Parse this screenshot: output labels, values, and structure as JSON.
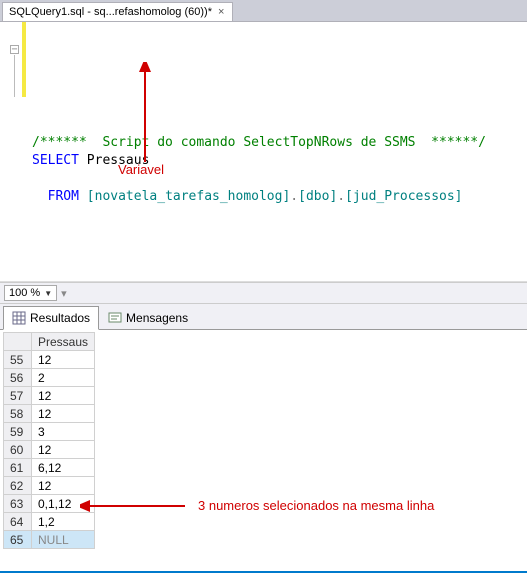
{
  "tab": {
    "title": "SQLQuery1.sql - sq...refashomolog (60))*"
  },
  "code": {
    "comment": "/******  Script do comando SelectTopNRows de SSMS  ******/",
    "select_kw": "SELECT",
    "select_col": "Pressaus",
    "from_kw": "FROM",
    "obj_open": "[",
    "obj_db": "novatela_tarefas_homolog",
    "obj_sep": "].[",
    "obj_schema": "dbo",
    "obj_sep2": "].[",
    "obj_table": "jud_Processos",
    "obj_close": "]"
  },
  "annotations": {
    "variavel": "Variavel",
    "rowline": "3 numeros selecionados na mesma linha"
  },
  "zoom": {
    "value": "100 %"
  },
  "result_tabs": {
    "results": "Resultados",
    "messages": "Mensagens"
  },
  "grid": {
    "column": "Pressaus",
    "rows": [
      {
        "n": "55",
        "v": "12"
      },
      {
        "n": "56",
        "v": "2"
      },
      {
        "n": "57",
        "v": "12"
      },
      {
        "n": "58",
        "v": "12"
      },
      {
        "n": "59",
        "v": "3"
      },
      {
        "n": "60",
        "v": "12"
      },
      {
        "n": "61",
        "v": "6,12"
      },
      {
        "n": "62",
        "v": "12"
      },
      {
        "n": "63",
        "v": "0,1,12"
      },
      {
        "n": "64",
        "v": "1,2"
      },
      {
        "n": "65",
        "v": "NULL",
        "null": true
      }
    ]
  }
}
